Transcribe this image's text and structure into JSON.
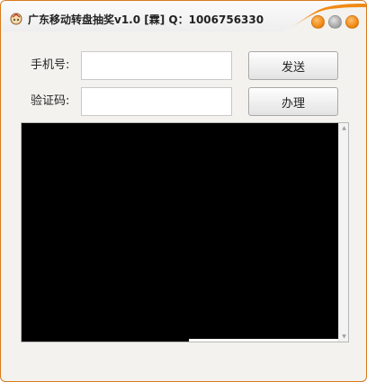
{
  "window": {
    "title": "广东移动转盘抽奖v1.0  [霖] Q：1006756330",
    "icon": "app-logo-icon",
    "accent_color": "#f08a16",
    "controls": {
      "minimize": "minimize-icon",
      "maximize": "maximize-icon",
      "close": "close-icon"
    }
  },
  "form": {
    "phone_label": "手机号:",
    "phone_value": "",
    "code_label": "验证码:",
    "code_value": "",
    "send_button": "发送",
    "apply_button": "办理"
  },
  "console": {
    "background": "#000000",
    "scroll_up": "▲",
    "scroll_down": "▼"
  }
}
